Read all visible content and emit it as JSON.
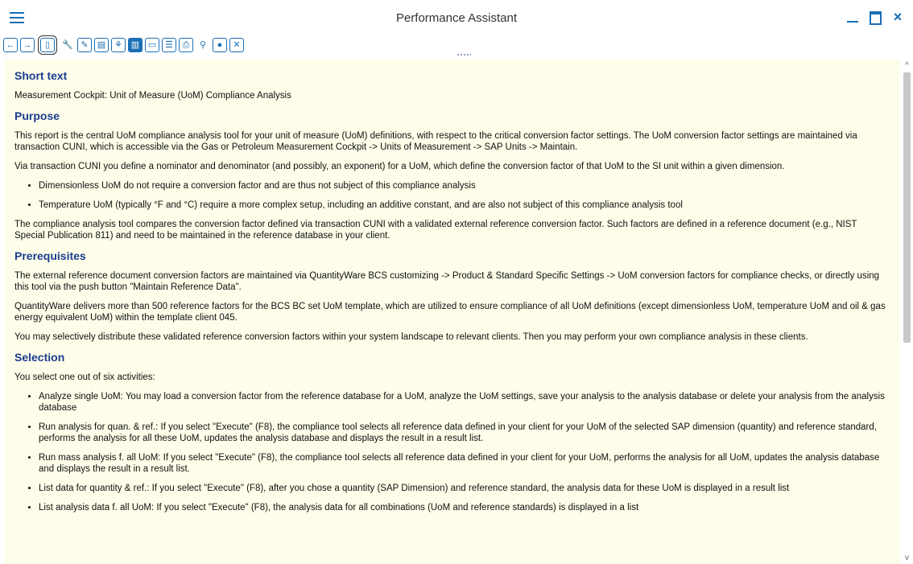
{
  "window": {
    "title": "Performance Assistant",
    "minimize_icon": "minimize-icon",
    "maximize_icon": "maximize-icon",
    "close_glyph": "×"
  },
  "toolbar": {
    "back_glyph": "←",
    "forward_glyph": "→",
    "buttons": [
      {
        "icon": "document-icon",
        "glyph": "▯"
      },
      {
        "icon": "wrench-icon",
        "glyph": "🔧"
      },
      {
        "icon": "edit-icon",
        "glyph": "✎"
      },
      {
        "icon": "stamp-icon",
        "glyph": "▤"
      },
      {
        "icon": "network-icon",
        "glyph": "⚘"
      },
      {
        "icon": "book-icon",
        "glyph": "▥"
      },
      {
        "icon": "card-icon",
        "glyph": "▭"
      },
      {
        "icon": "list-icon",
        "glyph": "☰"
      },
      {
        "icon": "print-icon",
        "glyph": "⎙"
      },
      {
        "icon": "search-plus-icon",
        "glyph": "⚲"
      },
      {
        "icon": "user-icon",
        "glyph": "●"
      },
      {
        "icon": "close-box-icon",
        "glyph": "✕"
      }
    ]
  },
  "content": {
    "short_text_heading": "Short text",
    "short_text": "Measurement Cockpit: Unit of Measure (UoM) Compliance Analysis",
    "purpose_heading": "Purpose",
    "purpose_p1": "This report is the central UoM compliance analysis tool for your unit of measure (UoM) definitions, with respect to the critical conversion factor settings. The UoM conversion factor settings are maintained via transaction CUNI, which is accessible via the Gas or Petroleum Measurement Cockpit -> Units of Measurement -> SAP Units -> Maintain.",
    "purpose_p2": "Via transaction CUNI you define a nominator and denominator (and possibly, an exponent) for a UoM, which define the conversion factor of that UoM to the SI unit within a given dimension.",
    "purpose_bullets": [
      "Dimensionless UoM do not require a conversion factor and are thus not subject of this compliance analysis",
      "Temperature UoM (typically °F and °C) require a more complex setup, including an additive constant, and are also not subject of this compliance analysis tool"
    ],
    "purpose_p3": "The compliance analysis tool compares the conversion factor defined via transaction CUNI with a validated external reference conversion factor. Such factors are defined in a reference document (e.g., NIST Special Publication 811) and need to be maintained in the reference database in your client.",
    "prereq_heading": "Prerequisites",
    "prereq_p1": "The external reference document conversion factors are maintained via QuantityWare BCS customizing -> Product & Standard Specific Settings -> UoM conversion factors for compliance checks, or directly using this tool via the push button \"Maintain Reference Data\".",
    "prereq_p2": "QuantityWare delivers more than 500 reference factors for the BCS BC set UoM template, which are utilized to ensure compliance of all UoM definitions (except dimensionless UoM, temperature UoM and oil & gas energy equivalent UoM) within the template client 045.",
    "prereq_p3": "You may selectively distribute these validated reference conversion factors within your system landscape to relevant clients. Then you may perform your own compliance analysis in these clients.",
    "selection_heading": "Selection",
    "selection_p1": "You select one out of six activities:",
    "selection_bullets": [
      "Analyze single UoM: You may load a conversion factor from the reference database for a UoM, analyze the UoM settings, save your analysis to the analysis database or delete your analysis from the analysis database",
      "Run analysis for quan. & ref.: If you select \"Execute\" (F8), the compliance tool selects all reference data defined in your client for your UoM of the selected SAP dimension (quantity) and reference standard, performs the analysis for all these UoM, updates the analysis database and displays the result in a result list.",
      "Run mass analysis f. all UoM: If you select \"Execute\" (F8), the compliance tool selects all reference data defined in your client for your UoM, performs the analysis for all UoM, updates the analysis database and displays the result in a result list.",
      "List data for quantity & ref.: If you select \"Execute\" (F8), after you chose a quantity (SAP Dimension) and reference standard, the analysis data for these UoM is displayed in a result list",
      "List analysis data f. all UoM: If you select \"Execute\" (F8), the analysis data for all combinations (UoM and reference standards) is displayed in a list"
    ]
  },
  "scrollbar": {
    "up_glyph": "^",
    "down_glyph": "v"
  }
}
